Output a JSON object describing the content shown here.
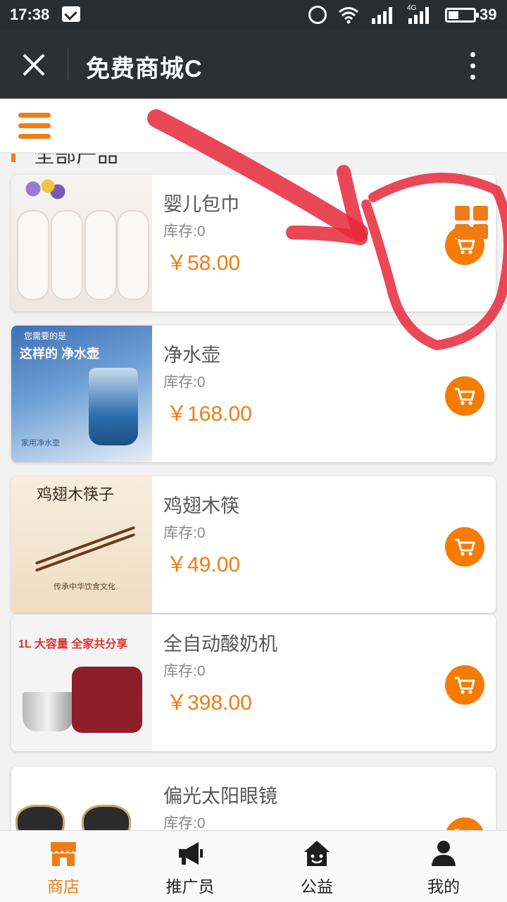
{
  "status_bar": {
    "time": "17:38",
    "network_type": "4G",
    "battery": "39"
  },
  "title_bar": {
    "title": "免费商城C"
  },
  "section": {
    "label": "全部产品"
  },
  "products": [
    {
      "name": "婴儿包巾",
      "stock": "库存:0",
      "price": "￥58.00"
    },
    {
      "name": "净水壶",
      "stock": "库存:0",
      "price": "￥168.00"
    },
    {
      "name": "鸡翅木筷",
      "stock": "库存:0",
      "price": "￥49.00"
    },
    {
      "name": "全自动酸奶机",
      "stock": "库存:0",
      "price": "￥398.00"
    },
    {
      "name": "偏光太阳眼镜",
      "stock": "库存:0",
      "price": ""
    }
  ],
  "thumbnails": {
    "pitcher_tag1": "您需要的是",
    "pitcher_tag2": "这样的 净水壶",
    "pitcher_tag3": "家用净水壶",
    "chopsticks_title": "鸡翅木筷子",
    "chopsticks_caption": "传承中华饮食文化",
    "yogurt_title": "1L 大容量 全家共分享"
  },
  "bottom_nav": [
    {
      "label": "商店",
      "icon": "store-icon",
      "active": true
    },
    {
      "label": "推广员",
      "icon": "megaphone-icon",
      "active": false
    },
    {
      "label": "公益",
      "icon": "charity-house-icon",
      "active": false
    },
    {
      "label": "我的",
      "icon": "user-icon",
      "active": false
    }
  ],
  "colors": {
    "accent": "#f07c17",
    "annotation_red": "#e8283a",
    "title_bar_bg": "#2c3033"
  }
}
